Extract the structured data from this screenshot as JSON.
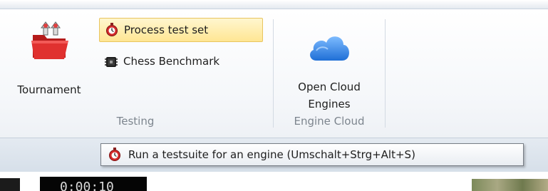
{
  "ribbon": {
    "testing_group": {
      "label": "Testing",
      "tournament": {
        "label": "Tournament",
        "icon": "tournament-icon"
      },
      "process_test_set": {
        "label": "Process test set",
        "icon": "stopwatch-icon",
        "state": "hover"
      },
      "chess_benchmark": {
        "label": "Chess Benchmark",
        "icon": "benchmark-chip-icon"
      }
    },
    "engine_cloud_group": {
      "label": "Engine Cloud",
      "open_cloud_engines": {
        "label_line1": "Open Cloud",
        "label_line2": "Engines",
        "icon": "cloud-icon"
      }
    }
  },
  "tooltip": {
    "text": "Run a testsuite for an engine (Umschalt+Strg+Alt+S)",
    "icon": "stopwatch-icon"
  },
  "clock": {
    "text": "0:00:10"
  },
  "colors": {
    "hover_fill": "#ffe693",
    "cloud_blue": "#2e7fe0",
    "folder_red": "#d42a2a"
  }
}
